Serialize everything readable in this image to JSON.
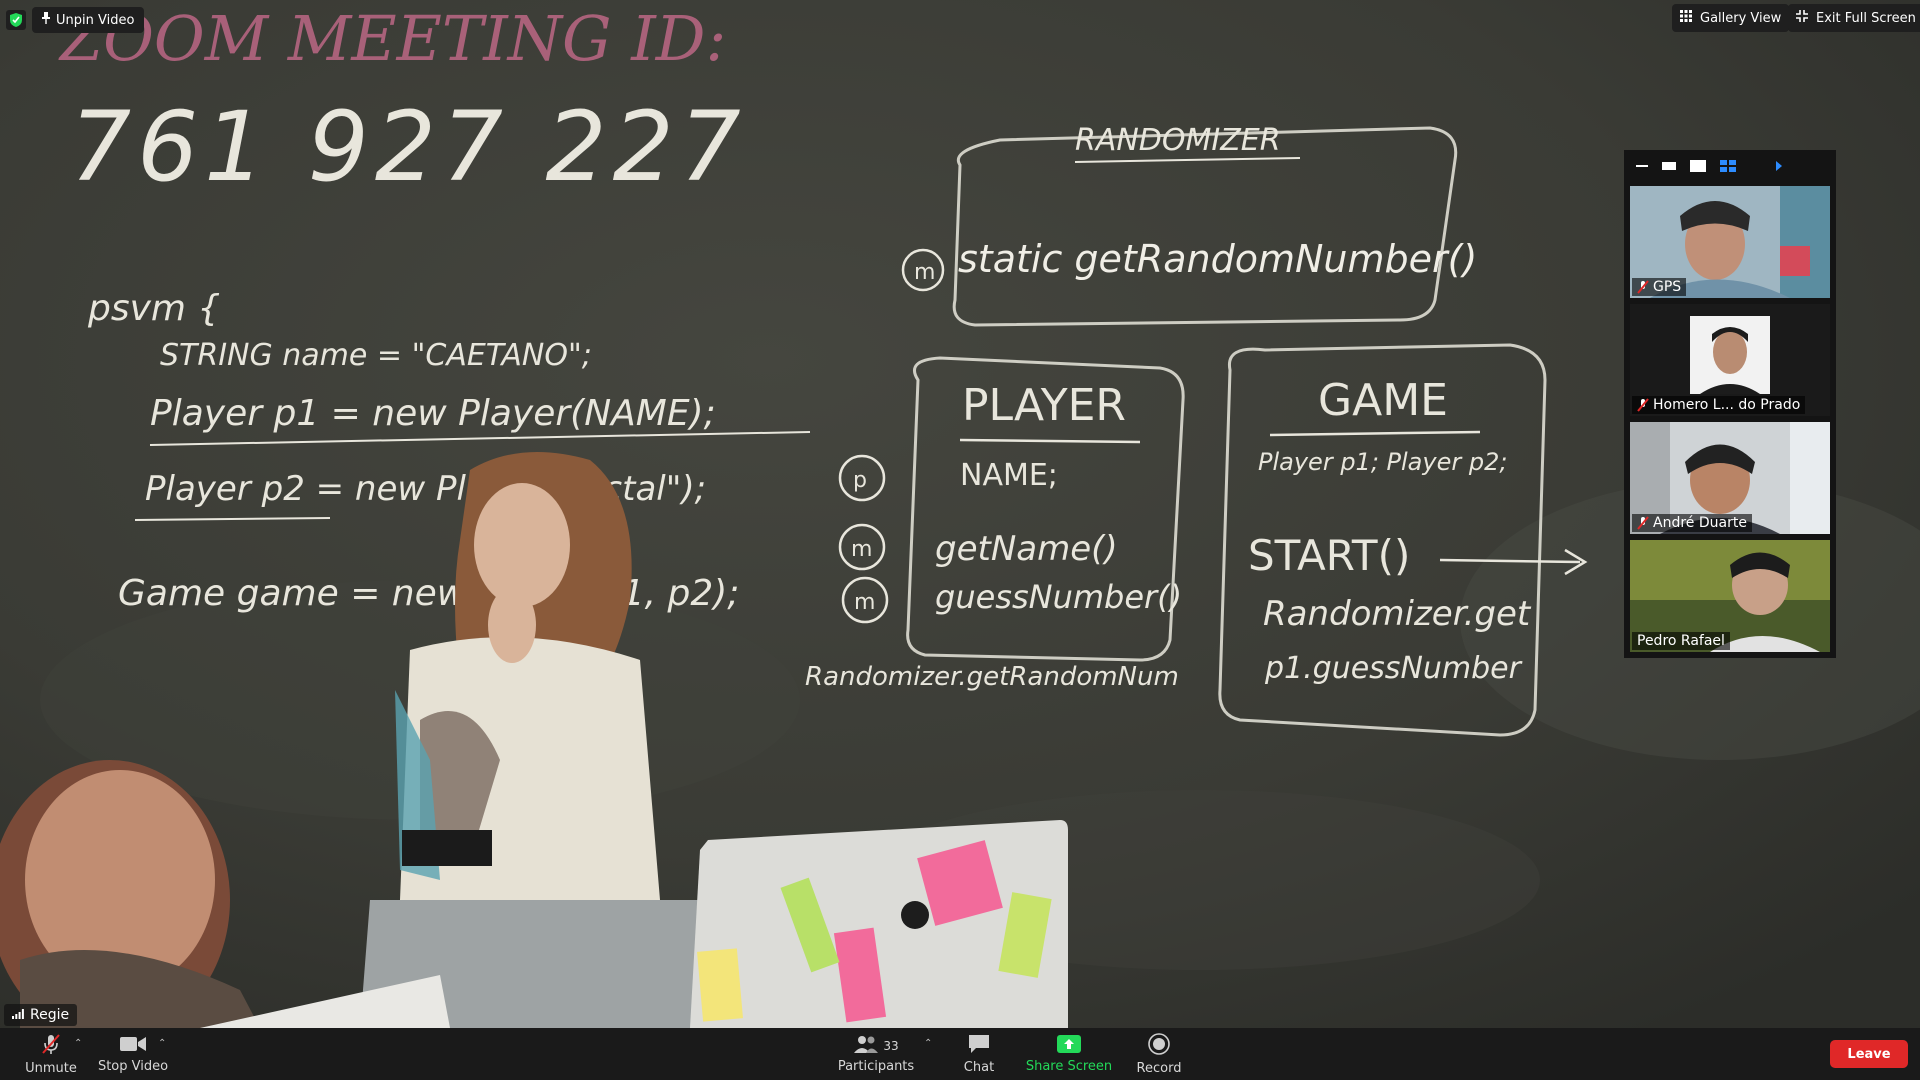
{
  "top_left": {
    "unpin_label": "Unpin Video"
  },
  "top_right": {
    "gallery_label": "Gallery View",
    "exit_fullscreen_label": "Exit Full Screen"
  },
  "board": {
    "line1": "ZOOM MEETING ID:",
    "meeting_id": "761 927 227",
    "randomizer_title": "RANDOMIZER",
    "randomizer_method": "static getRandomNumber()",
    "psvm": "psvm {",
    "code1": "STRING name = \"CAETANO\";",
    "code2": "Player p1 = new Player(NAME);",
    "code3": "Player p2 = new Player(\"Victal\");",
    "code4": "Game game = new Game(p1, p2);",
    "player_title": "PLAYER",
    "player_field": "NAME;",
    "player_m1": "getName()",
    "player_m2": "guessNumber()",
    "player_footer": "Randomizer.getRandomNum",
    "game_title": "GAME",
    "game_fields": "Player p1; Player p2;",
    "game_start": "START()",
    "game_body1": "Randomizer.get",
    "game_body2": "p1.guessNumber"
  },
  "speaker": {
    "name": "Regie"
  },
  "thumbnails": [
    {
      "name": "GPS",
      "muted": true
    },
    {
      "name": "Homero L... do Prado",
      "muted": true
    },
    {
      "name": "André Duarte",
      "muted": true
    },
    {
      "name": "Pedro Rafael",
      "muted": false
    }
  ],
  "toolbar": {
    "unmute": "Unmute",
    "stop_video": "Stop Video",
    "participants": "Participants",
    "participants_count": "33",
    "chat": "Chat",
    "share_screen": "Share Screen",
    "record": "Record",
    "leave": "Leave"
  },
  "colors": {
    "leave": "#e02828",
    "share": "#23d959",
    "muted_red": "#e02828",
    "chalk": "#e8e6dc",
    "pink_chalk": "#c46a8a"
  }
}
